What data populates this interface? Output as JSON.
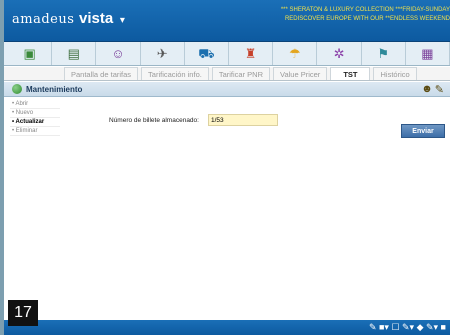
{
  "header": {
    "brand": "amadeus",
    "product": "vista",
    "brand_menu_caret": "▾",
    "ticker_line1": "*** SHERATON & LUXURY COLLECTION ***FRIDAY-SUNDAY",
    "ticker_line2": "REDISCOVER EUROPE WITH OUR **ENDLESS WEEKEND"
  },
  "toolbar": {
    "icons": [
      {
        "name": "cube-icon",
        "glyph": "▣",
        "color": "#3a8a3a"
      },
      {
        "name": "book-icon",
        "glyph": "▤",
        "color": "#3f6f3f"
      },
      {
        "name": "person-icon",
        "glyph": "☺",
        "color": "#7a3f9a"
      },
      {
        "name": "airplane-icon",
        "glyph": "✈",
        "color": "#555555"
      },
      {
        "name": "car-icon",
        "glyph": "⛟",
        "color": "#1b6fae"
      },
      {
        "name": "agent-icon",
        "glyph": "♜",
        "color": "#c6402a"
      },
      {
        "name": "umbrella-icon",
        "glyph": "☂",
        "color": "#e3a51e"
      },
      {
        "name": "gear-icon",
        "glyph": "✲",
        "color": "#8a3fa8"
      },
      {
        "name": "flag-icon",
        "glyph": "⚑",
        "color": "#2f8a9a"
      },
      {
        "name": "more-icon",
        "glyph": "▦",
        "color": "#7a3f9a"
      }
    ]
  },
  "tabs": [
    {
      "label": "Pantalla de tarifas",
      "active": false
    },
    {
      "label": "Tarificación info.",
      "active": false
    },
    {
      "label": "Tarificar PNR",
      "active": false
    },
    {
      "label": "Value Pricer",
      "active": false
    },
    {
      "label": "TST",
      "active": true
    },
    {
      "label": "Histórico",
      "active": false
    }
  ],
  "section": {
    "title": "Mantenimiento",
    "tool_icons": [
      "☻",
      "✎"
    ]
  },
  "menu": {
    "items": [
      {
        "label": "Abrir",
        "active": false
      },
      {
        "label": "Nuevo",
        "active": false
      },
      {
        "label": "Actualizar",
        "active": true
      },
      {
        "label": "Eliminar",
        "active": false
      }
    ]
  },
  "form": {
    "ticket_label": "Número de billete almacenado:",
    "ticket_value": "1/53",
    "submit_label": "Enviar"
  },
  "status_bar": {
    "tools": "✎ ■▾ ☐ ✎▾  ◆ ✎▾ ■"
  },
  "step_badge": "17",
  "colors": {
    "header_blue": "#0d5aa0",
    "ticker_yellow": "#f2e24a",
    "input_yellow": "#fff6c8",
    "button_blue": "#3d6ea8"
  }
}
